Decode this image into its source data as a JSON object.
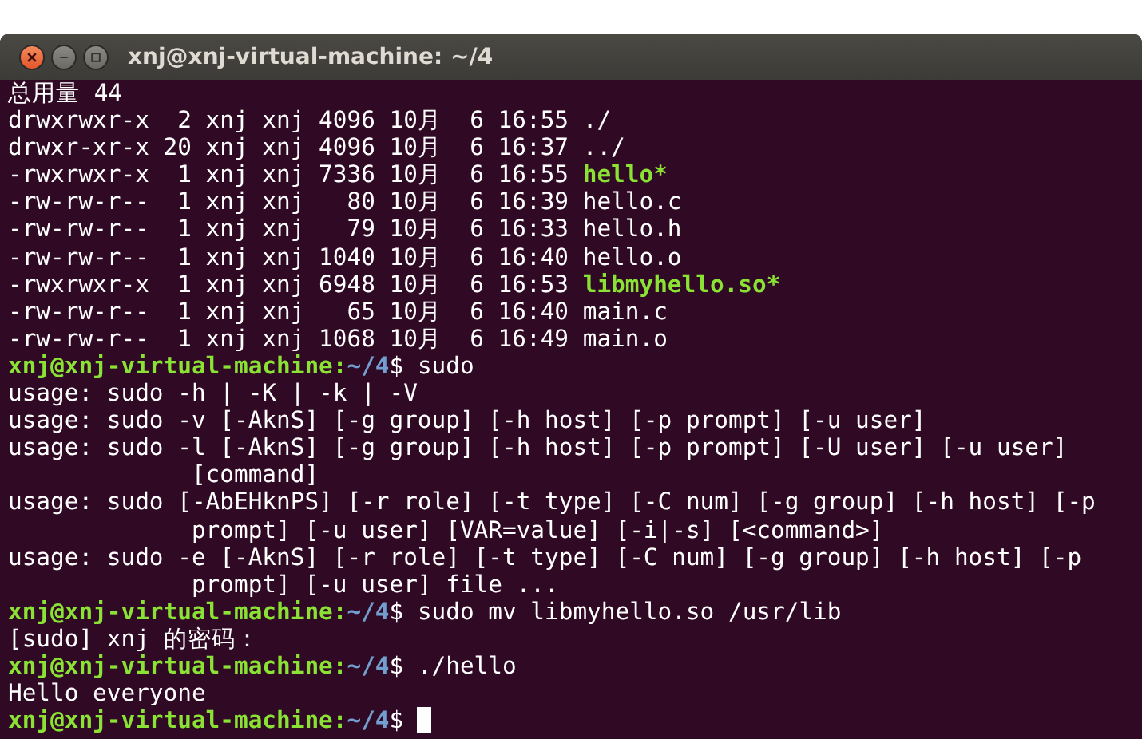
{
  "window": {
    "title": "xnj@xnj-virtual-machine: ~/4"
  },
  "terminal_lines": [
    {
      "kind": "output",
      "text": "总用量 44"
    },
    {
      "kind": "listing",
      "info": "drwxrwxr-x  2 xnj xnj 4096 10月  6 16:55",
      "name": "./",
      "executable": false
    },
    {
      "kind": "listing",
      "info": "drwxr-xr-x 20 xnj xnj 4096 10月  6 16:37",
      "name": "../",
      "executable": false
    },
    {
      "kind": "listing",
      "info": "-rwxrwxr-x  1 xnj xnj 7336 10月  6 16:55",
      "name": "hello*",
      "executable": true
    },
    {
      "kind": "listing",
      "info": "-rw-rw-r--  1 xnj xnj   80 10月  6 16:39",
      "name": "hello.c",
      "executable": false
    },
    {
      "kind": "listing",
      "info": "-rw-rw-r--  1 xnj xnj   79 10月  6 16:33",
      "name": "hello.h",
      "executable": false
    },
    {
      "kind": "listing",
      "info": "-rw-rw-r--  1 xnj xnj 1040 10月  6 16:40",
      "name": "hello.o",
      "executable": false
    },
    {
      "kind": "listing",
      "info": "-rwxrwxr-x  1 xnj xnj 6948 10月  6 16:53",
      "name": "libmyhello.so*",
      "executable": true
    },
    {
      "kind": "listing",
      "info": "-rw-rw-r--  1 xnj xnj   65 10月  6 16:40",
      "name": "main.c",
      "executable": false
    },
    {
      "kind": "listing",
      "info": "-rw-rw-r--  1 xnj xnj 1068 10月  6 16:49",
      "name": "main.o",
      "executable": false
    },
    {
      "kind": "prompt",
      "user_host": "xnj@xnj-virtual-machine",
      "separator": ":",
      "path": "~/4",
      "symbol": "$",
      "command": "sudo",
      "cursor": false
    },
    {
      "kind": "output",
      "text": "usage: sudo -h | -K | -k | -V"
    },
    {
      "kind": "output",
      "text": "usage: sudo -v [-AknS] [-g group] [-h host] [-p prompt] [-u user]"
    },
    {
      "kind": "output",
      "text": "usage: sudo -l [-AknS] [-g group] [-h host] [-p prompt] [-U user] [-u user]"
    },
    {
      "kind": "continuation",
      "text": "[command]"
    },
    {
      "kind": "output",
      "text": "usage: sudo [-AbEHknPS] [-r role] [-t type] [-C num] [-g group] [-h host] [-p"
    },
    {
      "kind": "continuation",
      "text": "prompt] [-u user] [VAR=value] [-i|-s] [<command>]"
    },
    {
      "kind": "output",
      "text": "usage: sudo -e [-AknS] [-r role] [-t type] [-C num] [-g group] [-h host] [-p"
    },
    {
      "kind": "continuation",
      "text": "prompt] [-u user] file ..."
    },
    {
      "kind": "prompt",
      "user_host": "xnj@xnj-virtual-machine",
      "separator": ":",
      "path": "~/4",
      "symbol": "$",
      "command": "sudo mv libmyhello.so /usr/lib",
      "cursor": false
    },
    {
      "kind": "output",
      "text": "[sudo] xnj 的密码："
    },
    {
      "kind": "prompt",
      "user_host": "xnj@xnj-virtual-machine",
      "separator": ":",
      "path": "~/4",
      "symbol": "$",
      "command": "./hello",
      "cursor": false
    },
    {
      "kind": "output",
      "text": "Hello everyone"
    },
    {
      "kind": "prompt",
      "user_host": "xnj@xnj-virtual-machine",
      "separator": ":",
      "path": "~/4",
      "symbol": "$",
      "cursor": true
    }
  ]
}
